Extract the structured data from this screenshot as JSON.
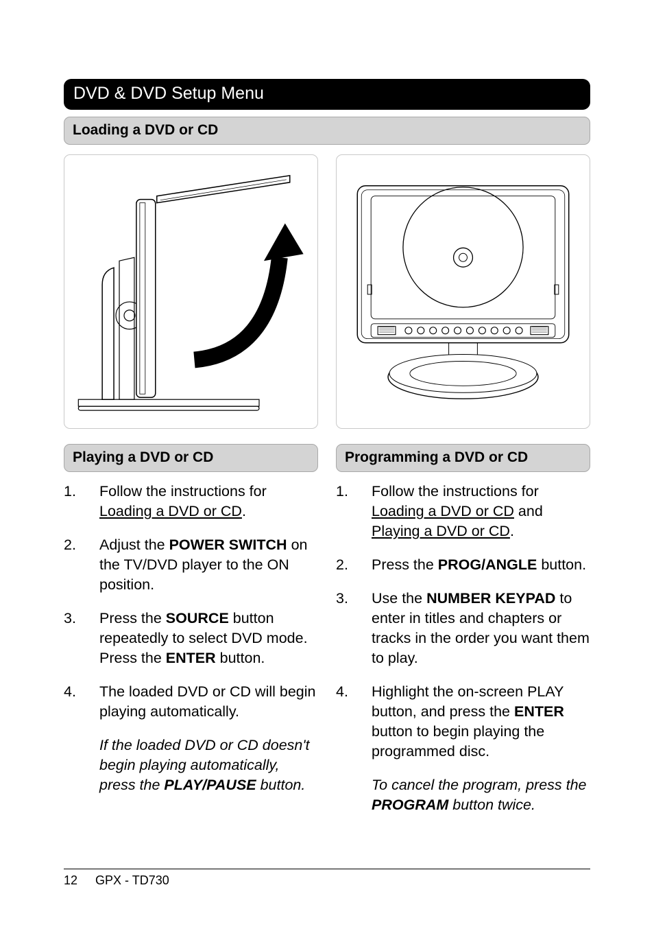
{
  "section_title": "DVD & DVD Setup Menu",
  "loading_heading": "Loading a DVD or CD",
  "playing": {
    "heading": "Playing a DVD or CD",
    "s1_a": "Follow the instructions for ",
    "s1_link": "Loading a DVD or CD",
    "s1_b": ".",
    "s2_a": "Adjust the ",
    "s2_bold": "POWER SWITCH",
    "s2_b": " on the TV/DVD player to the ON position.",
    "s3_a": "Press the ",
    "s3_bold1": "SOURCE",
    "s3_b": " button repeatedly to select DVD mode. Press the ",
    "s3_bold2": "ENTER",
    "s3_c": " button.",
    "s4": "The loaded DVD or CD will begin playing automatically.",
    "note_a": "If the loaded DVD or CD doesn't begin playing automatically, press the ",
    "note_bold": "PLAY/PAUSE",
    "note_b": " button."
  },
  "programming": {
    "heading": "Programming a DVD or CD",
    "s1_a": "Follow the instructions for ",
    "s1_link1": "Loading a DVD or CD",
    "s1_b": " and ",
    "s1_link2": "Playing a DVD or CD",
    "s1_c": ".",
    "s2_a": "Press the ",
    "s2_bold": "PROG/ANGLE",
    "s2_b": " button.",
    "s3_a": "Use the ",
    "s3_bold": "NUMBER KEYPAD",
    "s3_b": " to enter in titles and chapters or tracks in the order you want them to play.",
    "s4_a": "Highlight the on-screen PLAY button, and press the ",
    "s4_bold": "ENTER",
    "s4_b": " button to begin playing the programmed disc.",
    "note_a": "To cancel the program, press the ",
    "note_bold": "PROGRAM",
    "note_b": " button twice."
  },
  "nums": {
    "n1": "1.",
    "n2": "2.",
    "n3": "3.",
    "n4": "4."
  },
  "footer": {
    "page_number": "12",
    "model": "GPX - TD730"
  }
}
